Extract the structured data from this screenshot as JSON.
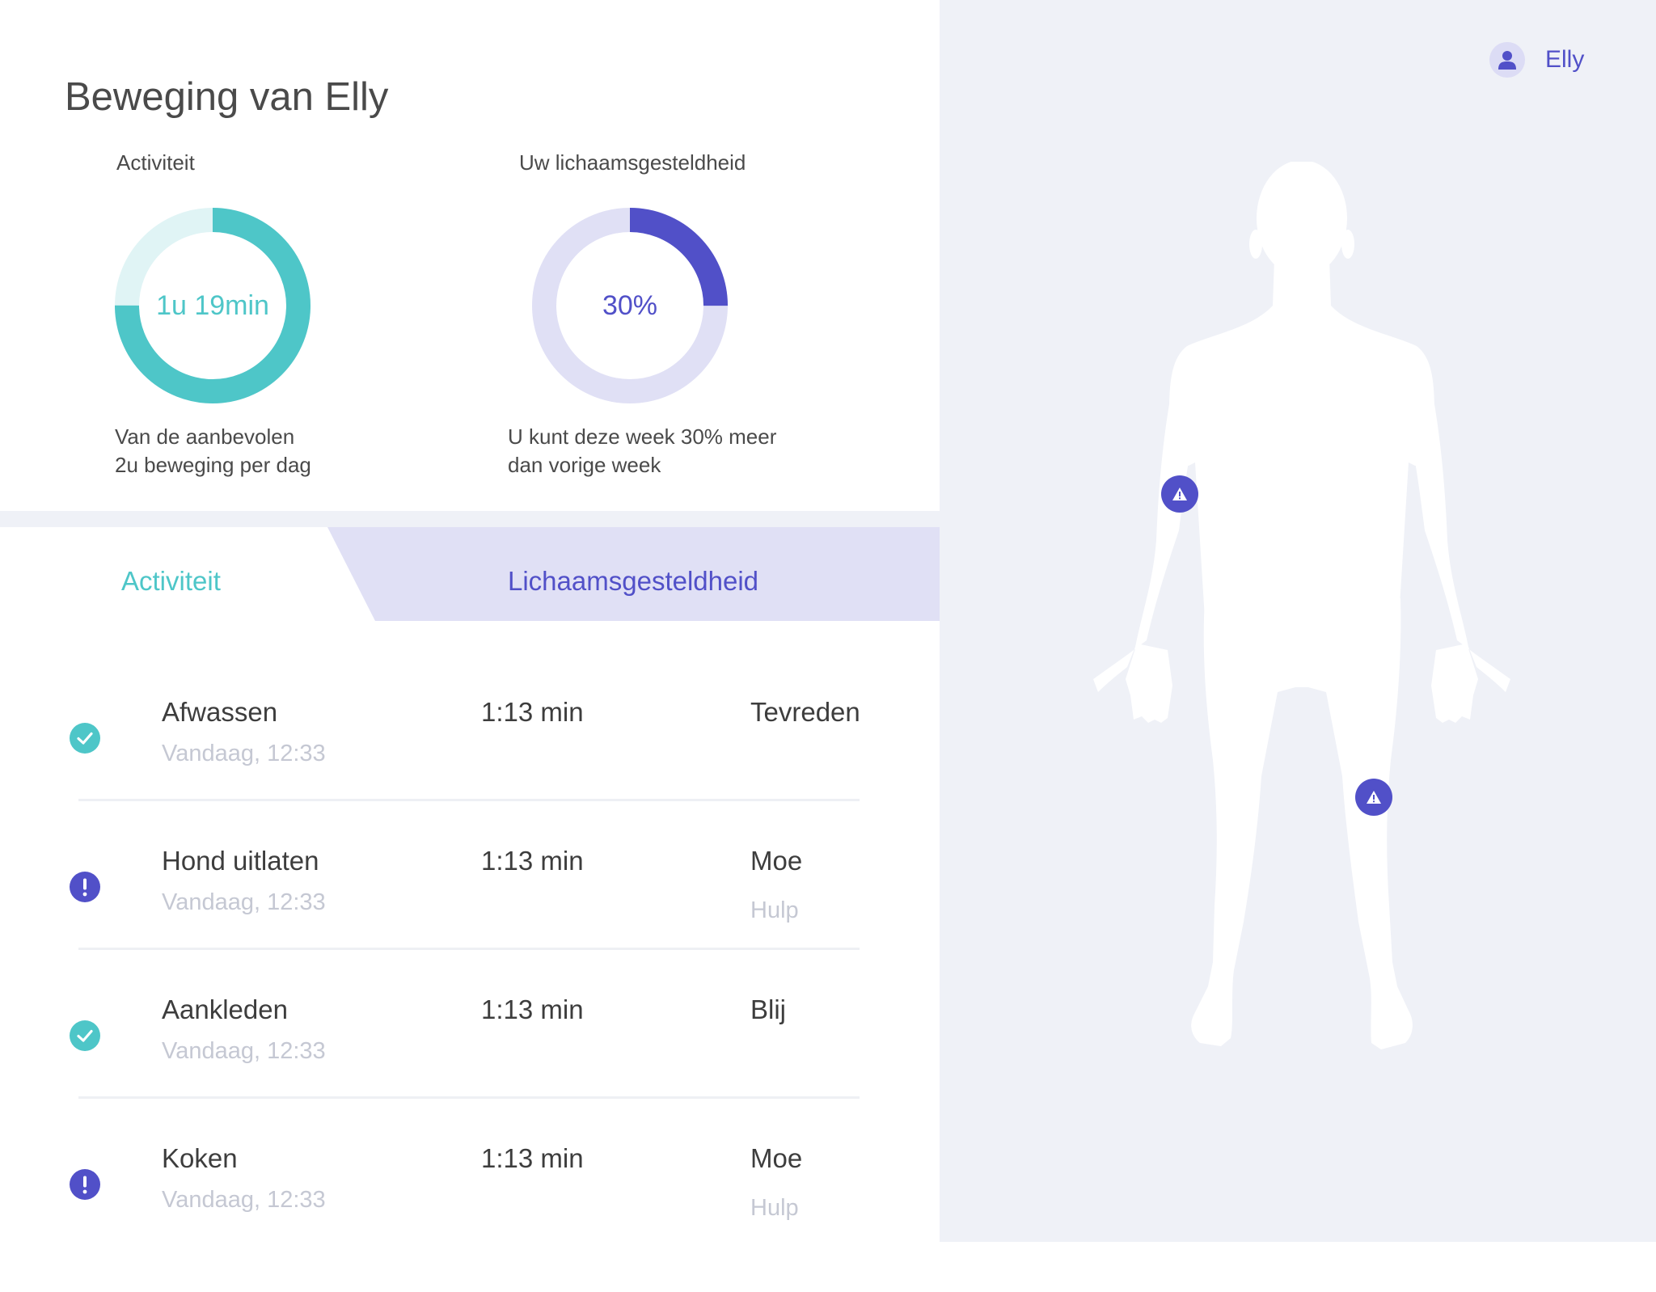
{
  "page": {
    "title": "Beweging van Elly"
  },
  "user": {
    "name": "Elly",
    "icon": "user-icon"
  },
  "colors": {
    "teal": "#4ec6c8",
    "teal_light": "#e0f4f5",
    "purple": "#5150c8",
    "purple_light": "#e0e0f5",
    "panel_bg": "#eff1f7"
  },
  "cards": [
    {
      "label": "Activiteit",
      "value": "1u 19min",
      "progress": 0.75,
      "description_line1": "Van de aanbevolen",
      "description_line2": "2u beweging per dag"
    },
    {
      "label": "Uw lichaamsgesteldheid",
      "value": "30%",
      "progress": 0.25,
      "description_line1": "U kunt deze week 30% meer",
      "description_line2": "dan vorige week"
    }
  ],
  "tabs": [
    {
      "label": "Activiteit",
      "active": true
    },
    {
      "label": "Lichaamsgesteldheid",
      "active": false
    }
  ],
  "activities": [
    {
      "name": "Afwassen",
      "time": "Vandaag, 12:33",
      "duration": "1:13 min",
      "mood": "Tevreden",
      "status": "ok",
      "icon": "check-icon"
    },
    {
      "name": "Hond uitlaten",
      "time": "Vandaag, 12:33",
      "duration": "1:13 min",
      "mood": "Moe",
      "help": "Hulp",
      "status": "alert",
      "icon": "exclamation-icon"
    },
    {
      "name": "Aankleden",
      "time": "Vandaag, 12:33",
      "duration": "1:13 min",
      "mood": "Blij",
      "status": "ok",
      "icon": "check-icon"
    },
    {
      "name": "Koken",
      "time": "Vandaag, 12:33",
      "duration": "1:13 min",
      "mood": "Moe",
      "help": "Hulp",
      "status": "alert",
      "icon": "exclamation-icon"
    }
  ],
  "body_map": {
    "markers": [
      {
        "name": "arm",
        "icon": "warning-icon"
      },
      {
        "name": "knee",
        "icon": "warning-icon"
      }
    ]
  }
}
